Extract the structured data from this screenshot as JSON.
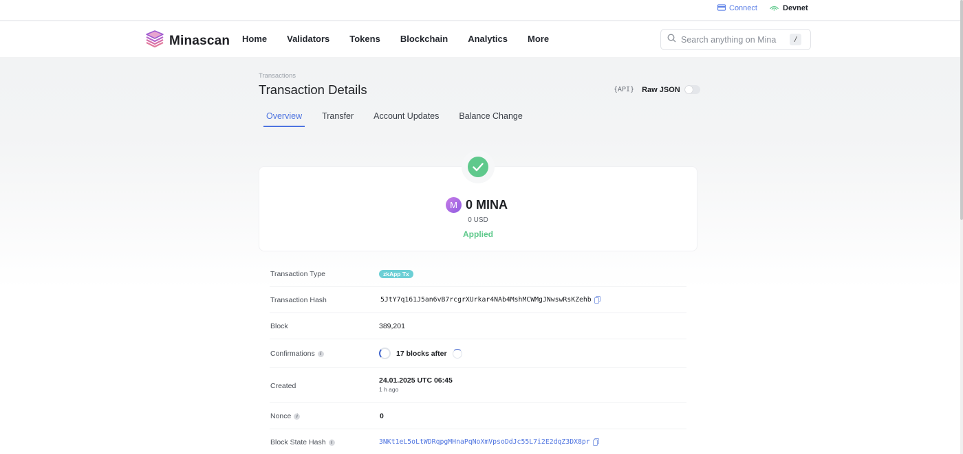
{
  "topbar": {
    "connect_label": "Connect",
    "network_label": "Devnet",
    "connect_color": "#5b7fe6"
  },
  "navbar": {
    "brand": "Minascan",
    "items": [
      {
        "label": "Home"
      },
      {
        "label": "Validators"
      },
      {
        "label": "Tokens"
      },
      {
        "label": "Blockchain"
      },
      {
        "label": "Analytics"
      },
      {
        "label": "More"
      }
    ],
    "search_placeholder": "Search anything on Mina",
    "search_shortcut": "/"
  },
  "page": {
    "breadcrumb": "Transactions",
    "title": "Transaction Details",
    "api_label": "{API}",
    "raw_json_label": "Raw JSON",
    "raw_json_enabled": false
  },
  "tabs": [
    {
      "label": "Overview",
      "active": true
    },
    {
      "label": "Transfer",
      "active": false
    },
    {
      "label": "Account Updates",
      "active": false
    },
    {
      "label": "Balance Change",
      "active": false
    }
  ],
  "summary": {
    "coin_glyph": "M",
    "amount": "0 MINA",
    "usd": "0 USD",
    "status": "Applied",
    "status_color": "#5fc98c"
  },
  "details": {
    "type": {
      "label": "Transaction Type",
      "value": "zkApp Tx"
    },
    "hash": {
      "label": "Transaction Hash",
      "value": "5JtY7q161J5an6vB7rcgrXUrkar4NAb4MshMCWMgJNwswRsKZehb"
    },
    "block": {
      "label": "Block",
      "value": "389,201"
    },
    "confirmations": {
      "label": "Confirmations",
      "value": "17 blocks after"
    },
    "created": {
      "label": "Created",
      "value": "24.01.2025 UTC 06:45",
      "relative": "1 h ago"
    },
    "nonce": {
      "label": "Nonce",
      "value": "0"
    },
    "state_hash": {
      "label": "Block State Hash",
      "value": "3NKt1eL5oLtWDRqpgMHnaPqNoXmVpsoDdJc55L7i2E2dqZ3DX8pr"
    }
  }
}
